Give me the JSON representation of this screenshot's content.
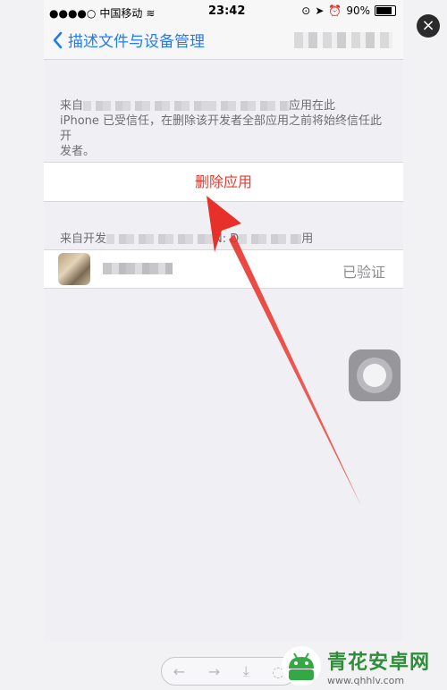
{
  "status_bar": {
    "carrier": "中国移动",
    "time": "23:42",
    "battery": "90%"
  },
  "nav": {
    "back_label": "描述文件与设备管理"
  },
  "trust_section": {
    "prefix": "来自",
    "suffix": "应用在此",
    "line2": "iPhone 已受信任，在删除该开发者全部应用之前将始终信任此开",
    "line3": "发者。"
  },
  "delete_button": {
    "label": "删除应用"
  },
  "apps_section": {
    "prefix": "来自开发",
    "middle": "N: D",
    "suffix": "用"
  },
  "app_row": {
    "status": "已验证"
  },
  "viewer": {
    "close_label": "×"
  },
  "watermark": {
    "title": "青花安卓网",
    "url": "www.qhhlv.com"
  },
  "colors": {
    "accent_blue": "#1f7cf4",
    "destructive_red": "#e23b2f",
    "arrow_red": "#e8302a"
  }
}
